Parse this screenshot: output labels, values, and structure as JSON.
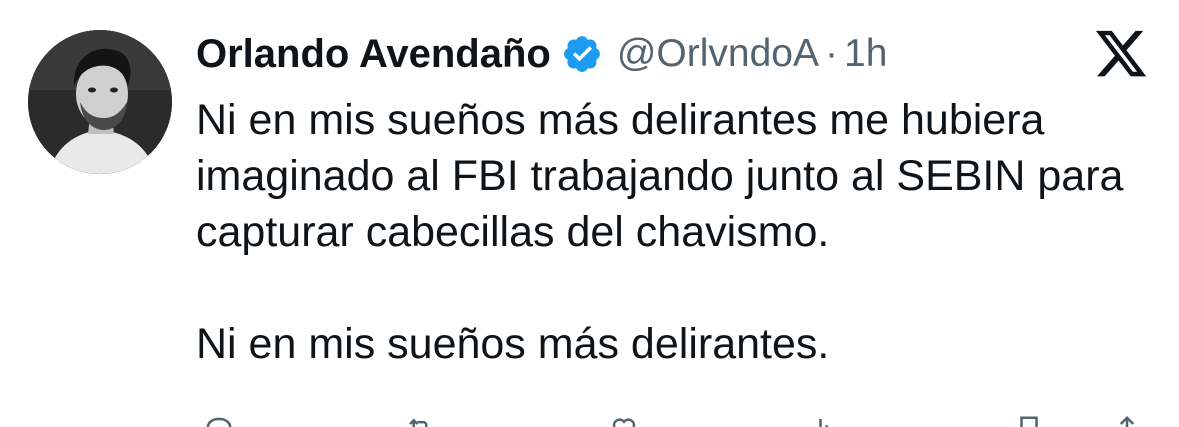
{
  "author": {
    "name": "Orlando Avendaño",
    "handle": "@OrlvndoA",
    "separator": "·",
    "time": "1h",
    "verified": true
  },
  "tweet": {
    "paragraphs": [
      "Ni en mis sueños más delirantes me hubiera imaginado al FBI trabajando junto al SEBIN para capturar cabecillas del chavismo.",
      "Ni en mis sueños más delirantes."
    ]
  },
  "icons": {
    "verified": "verified-badge-icon",
    "platform": "x-logo-icon",
    "actions": [
      "reply-icon",
      "repost-icon",
      "like-icon",
      "views-icon",
      "bookmark-icon",
      "share-icon"
    ]
  },
  "colors": {
    "text": "#0f1419",
    "secondary": "#536471",
    "verified_blue": "#1d9bf0"
  }
}
